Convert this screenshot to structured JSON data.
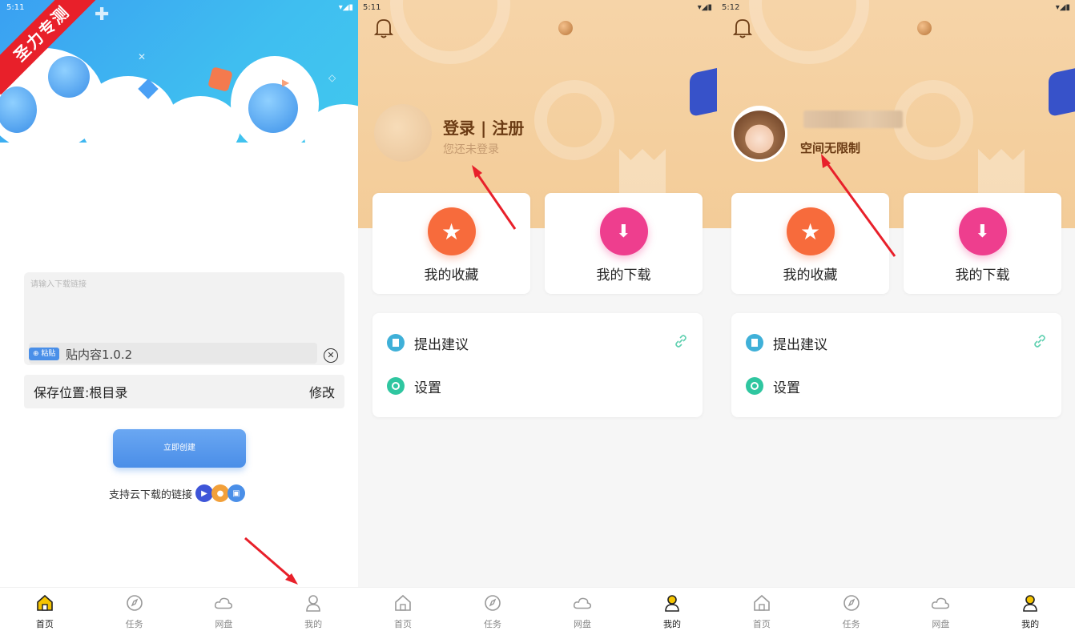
{
  "watermark": "圣力专测",
  "panel1": {
    "status_time": "5:11",
    "status_extra": "",
    "input_placeholder": "请输入下载链接",
    "paste_chip": "粘贴",
    "paste_text": "贴内容1.0.2",
    "save_label": "保存位置:根目录",
    "save_edit": "修改",
    "create_button": "立即创建",
    "support_text": "支持云下载的链接"
  },
  "panel2": {
    "status_time": "5:11",
    "login_title": "登录 | 注册",
    "login_sub": "您还未登录",
    "card_favorites": "我的收藏",
    "card_downloads": "我的下载",
    "menu_feedback": "提出建议",
    "menu_settings": "设置"
  },
  "panel3": {
    "status_time": "5:12",
    "space_label": "空间无限制",
    "card_favorites": "我的收藏",
    "card_downloads": "我的下载",
    "menu_feedback": "提出建议",
    "menu_settings": "设置"
  },
  "nav": {
    "home": "首页",
    "tasks": "任务",
    "cloud": "网盘",
    "mine": "我的"
  },
  "colors": {
    "accent_blue": "#4a8ee8",
    "favorite_orange": "#f76b3c",
    "download_pink": "#ee3e8e",
    "arrow_red": "#e8202a",
    "nav_active_yellow": "#f5c400"
  }
}
